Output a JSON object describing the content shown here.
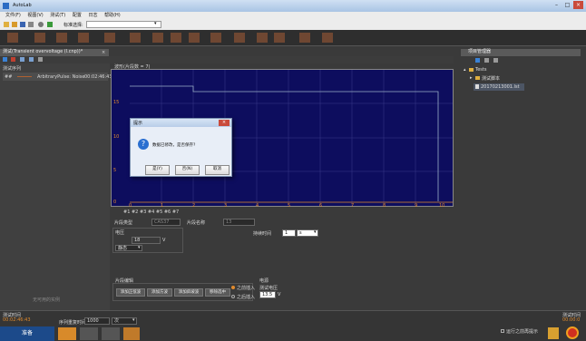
{
  "window": {
    "title": "AutoLab"
  },
  "menu": [
    "文件(F)",
    "视图(V)",
    "测试(T)",
    "配置",
    "日志",
    "帮助(H)"
  ],
  "toolbar1": {
    "combo_label": "标准选择:",
    "combo_value": ""
  },
  "doc_tab": {
    "title": "测试(Transient overvoltage (l.cnp))*",
    "close": "×"
  },
  "sequence": {
    "title": "测试序列",
    "rows": [
      {
        "id": "##",
        "name": "ArbitraryPulse: Noise",
        "time": "00:02:46:43"
      }
    ],
    "footer": "无可用的实例"
  },
  "waveform": {
    "title": "波形(片段数 = 7)",
    "y_ticks": [
      "15",
      "10",
      "5",
      "0"
    ],
    "x_ticks": [
      "0",
      "1",
      "2",
      "3",
      "4",
      "5",
      "6",
      "7",
      "8",
      "9",
      "10"
    ],
    "segments": [
      "#1",
      "#2",
      "#3",
      "#4",
      "#5",
      "#6",
      "#7"
    ]
  },
  "segment_props": {
    "type_label": "片段类型",
    "type_value": "CAS37",
    "name_label": "片段名称",
    "name_value": "13",
    "voltage_label": "电压",
    "voltage_value": "18",
    "voltage_unit": "V",
    "mode_value": "静态",
    "duration_label": "持续时间",
    "duration_value": "1",
    "duration_unit": "s"
  },
  "segment_edit": {
    "title": "片段编辑",
    "buttons": [
      "添加正弦波",
      "添加方波",
      "添加斜坡波",
      "移除选中"
    ],
    "insert_before": "之前插入",
    "insert_after": "之后插入",
    "power_label": "电源",
    "test_voltage_label": "测试电压",
    "test_voltage_value": "13.5",
    "test_voltage_unit": "V"
  },
  "project": {
    "title": "项目管理器",
    "tree": [
      "Tests",
      "测试脚本",
      "20170213001.lst"
    ]
  },
  "bottom": {
    "left_label": "测试时间",
    "left_time": "00:02:46:43",
    "repeat_label": "序列重复时间",
    "repeat_value": "1000",
    "repeat_unit": "次",
    "ready": "准备",
    "checkbox_label": "运行之前再提示",
    "right_label": "测试时间",
    "right_time": "00:00:0"
  },
  "dialog": {
    "title": "提示",
    "message": "数据已修改，是否保存?",
    "buttons": [
      "是(Y)",
      "否(N)",
      "取消"
    ]
  },
  "colors": {
    "chart_bg": "#0d0d5e",
    "accent": "#e08a2d",
    "ready_btn": "#1c4a8a"
  }
}
